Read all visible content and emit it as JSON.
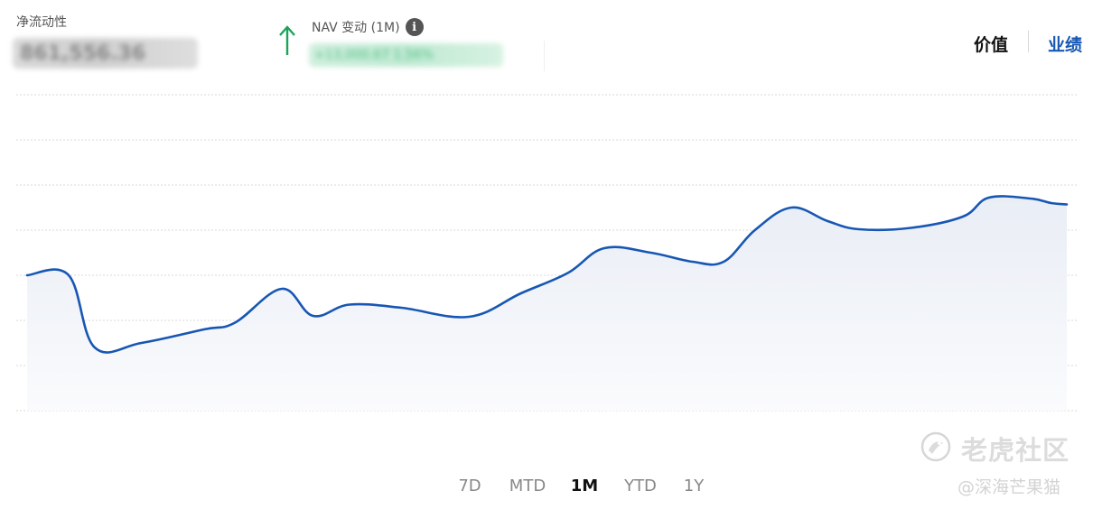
{
  "header": {
    "net_liquidity_label": "净流动性",
    "net_liquidity_value": "861,556.36",
    "nav_change_label": "NAV 变动 (1M)",
    "nav_change_value": "+13,000.67 1.56%",
    "info_icon": "info-icon",
    "arrow_icon": "arrow-up-icon"
  },
  "tabs": [
    {
      "label": "价值",
      "active": true
    },
    {
      "label": "业绩",
      "active": false
    }
  ],
  "range_buttons": [
    {
      "label": "7D",
      "active": false
    },
    {
      "label": "MTD",
      "active": false
    },
    {
      "label": "1M",
      "active": true
    },
    {
      "label": "YTD",
      "active": false
    },
    {
      "label": "1Y",
      "active": false
    }
  ],
  "watermark": {
    "brand": "老虎社区",
    "author": "@深海芒果猫"
  },
  "colors": {
    "line": "#1757b3",
    "fill": "#eef1f7",
    "up_arrow": "#1aa35a",
    "accent": "#1757b3"
  },
  "chart_data": {
    "type": "area",
    "grid": true,
    "ylim": [
      0,
      7
    ],
    "points": [
      [
        0,
        3.0
      ],
      [
        0.04,
        3.0
      ],
      [
        0.065,
        1.4
      ],
      [
        0.11,
        1.5
      ],
      [
        0.17,
        1.8
      ],
      [
        0.2,
        1.95
      ],
      [
        0.245,
        2.7
      ],
      [
        0.275,
        2.1
      ],
      [
        0.31,
        2.35
      ],
      [
        0.36,
        2.28
      ],
      [
        0.425,
        2.08
      ],
      [
        0.475,
        2.6
      ],
      [
        0.52,
        3.05
      ],
      [
        0.555,
        3.6
      ],
      [
        0.6,
        3.5
      ],
      [
        0.64,
        3.3
      ],
      [
        0.67,
        3.3
      ],
      [
        0.7,
        4.0
      ],
      [
        0.735,
        4.5
      ],
      [
        0.77,
        4.2
      ],
      [
        0.8,
        4.02
      ],
      [
        0.85,
        4.05
      ],
      [
        0.9,
        4.3
      ],
      [
        0.925,
        4.72
      ],
      [
        0.965,
        4.7
      ],
      [
        0.985,
        4.6
      ],
      [
        1.0,
        4.57
      ]
    ]
  }
}
